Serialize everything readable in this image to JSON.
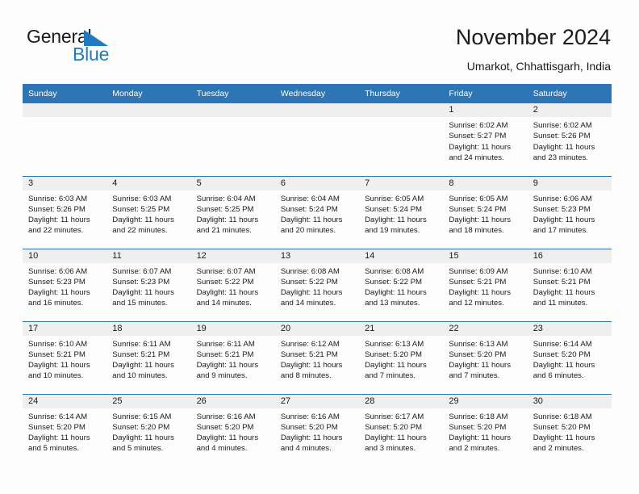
{
  "brand": {
    "name_part1": "General",
    "name_part2": "Blue",
    "triangle_color": "#1f7ac4"
  },
  "header": {
    "title": "November 2024",
    "subtitle": "Umarkot, Chhattisgarh, India"
  },
  "theme": {
    "header_blue": "#2e75b6",
    "daynum_bg": "#efefef",
    "text": "#1b1b1b",
    "page_bg": "#fdfdfd"
  },
  "weekday_headers": [
    "Sunday",
    "Monday",
    "Tuesday",
    "Wednesday",
    "Thursday",
    "Friday",
    "Saturday"
  ],
  "labels": {
    "sunrise_prefix": "Sunrise:",
    "sunset_prefix": "Sunset:",
    "daylight_prefix": "Daylight:"
  },
  "weeks": [
    [
      {
        "day": "",
        "empty": true
      },
      {
        "day": "",
        "empty": true
      },
      {
        "day": "",
        "empty": true
      },
      {
        "day": "",
        "empty": true
      },
      {
        "day": "",
        "empty": true
      },
      {
        "day": "1",
        "sunrise": "Sunrise: 6:02 AM",
        "sunset": "Sunset: 5:27 PM",
        "daylight": "Daylight: 11 hours and 24 minutes."
      },
      {
        "day": "2",
        "sunrise": "Sunrise: 6:02 AM",
        "sunset": "Sunset: 5:26 PM",
        "daylight": "Daylight: 11 hours and 23 minutes."
      }
    ],
    [
      {
        "day": "3",
        "sunrise": "Sunrise: 6:03 AM",
        "sunset": "Sunset: 5:26 PM",
        "daylight": "Daylight: 11 hours and 22 minutes."
      },
      {
        "day": "4",
        "sunrise": "Sunrise: 6:03 AM",
        "sunset": "Sunset: 5:25 PM",
        "daylight": "Daylight: 11 hours and 22 minutes."
      },
      {
        "day": "5",
        "sunrise": "Sunrise: 6:04 AM",
        "sunset": "Sunset: 5:25 PM",
        "daylight": "Daylight: 11 hours and 21 minutes."
      },
      {
        "day": "6",
        "sunrise": "Sunrise: 6:04 AM",
        "sunset": "Sunset: 5:24 PM",
        "daylight": "Daylight: 11 hours and 20 minutes."
      },
      {
        "day": "7",
        "sunrise": "Sunrise: 6:05 AM",
        "sunset": "Sunset: 5:24 PM",
        "daylight": "Daylight: 11 hours and 19 minutes."
      },
      {
        "day": "8",
        "sunrise": "Sunrise: 6:05 AM",
        "sunset": "Sunset: 5:24 PM",
        "daylight": "Daylight: 11 hours and 18 minutes."
      },
      {
        "day": "9",
        "sunrise": "Sunrise: 6:06 AM",
        "sunset": "Sunset: 5:23 PM",
        "daylight": "Daylight: 11 hours and 17 minutes."
      }
    ],
    [
      {
        "day": "10",
        "sunrise": "Sunrise: 6:06 AM",
        "sunset": "Sunset: 5:23 PM",
        "daylight": "Daylight: 11 hours and 16 minutes."
      },
      {
        "day": "11",
        "sunrise": "Sunrise: 6:07 AM",
        "sunset": "Sunset: 5:23 PM",
        "daylight": "Daylight: 11 hours and 15 minutes."
      },
      {
        "day": "12",
        "sunrise": "Sunrise: 6:07 AM",
        "sunset": "Sunset: 5:22 PM",
        "daylight": "Daylight: 11 hours and 14 minutes."
      },
      {
        "day": "13",
        "sunrise": "Sunrise: 6:08 AM",
        "sunset": "Sunset: 5:22 PM",
        "daylight": "Daylight: 11 hours and 14 minutes."
      },
      {
        "day": "14",
        "sunrise": "Sunrise: 6:08 AM",
        "sunset": "Sunset: 5:22 PM",
        "daylight": "Daylight: 11 hours and 13 minutes."
      },
      {
        "day": "15",
        "sunrise": "Sunrise: 6:09 AM",
        "sunset": "Sunset: 5:21 PM",
        "daylight": "Daylight: 11 hours and 12 minutes."
      },
      {
        "day": "16",
        "sunrise": "Sunrise: 6:10 AM",
        "sunset": "Sunset: 5:21 PM",
        "daylight": "Daylight: 11 hours and 11 minutes."
      }
    ],
    [
      {
        "day": "17",
        "sunrise": "Sunrise: 6:10 AM",
        "sunset": "Sunset: 5:21 PM",
        "daylight": "Daylight: 11 hours and 10 minutes."
      },
      {
        "day": "18",
        "sunrise": "Sunrise: 6:11 AM",
        "sunset": "Sunset: 5:21 PM",
        "daylight": "Daylight: 11 hours and 10 minutes."
      },
      {
        "day": "19",
        "sunrise": "Sunrise: 6:11 AM",
        "sunset": "Sunset: 5:21 PM",
        "daylight": "Daylight: 11 hours and 9 minutes."
      },
      {
        "day": "20",
        "sunrise": "Sunrise: 6:12 AM",
        "sunset": "Sunset: 5:21 PM",
        "daylight": "Daylight: 11 hours and 8 minutes."
      },
      {
        "day": "21",
        "sunrise": "Sunrise: 6:13 AM",
        "sunset": "Sunset: 5:20 PM",
        "daylight": "Daylight: 11 hours and 7 minutes."
      },
      {
        "day": "22",
        "sunrise": "Sunrise: 6:13 AM",
        "sunset": "Sunset: 5:20 PM",
        "daylight": "Daylight: 11 hours and 7 minutes."
      },
      {
        "day": "23",
        "sunrise": "Sunrise: 6:14 AM",
        "sunset": "Sunset: 5:20 PM",
        "daylight": "Daylight: 11 hours and 6 minutes."
      }
    ],
    [
      {
        "day": "24",
        "sunrise": "Sunrise: 6:14 AM",
        "sunset": "Sunset: 5:20 PM",
        "daylight": "Daylight: 11 hours and 5 minutes."
      },
      {
        "day": "25",
        "sunrise": "Sunrise: 6:15 AM",
        "sunset": "Sunset: 5:20 PM",
        "daylight": "Daylight: 11 hours and 5 minutes."
      },
      {
        "day": "26",
        "sunrise": "Sunrise: 6:16 AM",
        "sunset": "Sunset: 5:20 PM",
        "daylight": "Daylight: 11 hours and 4 minutes."
      },
      {
        "day": "27",
        "sunrise": "Sunrise: 6:16 AM",
        "sunset": "Sunset: 5:20 PM",
        "daylight": "Daylight: 11 hours and 4 minutes."
      },
      {
        "day": "28",
        "sunrise": "Sunrise: 6:17 AM",
        "sunset": "Sunset: 5:20 PM",
        "daylight": "Daylight: 11 hours and 3 minutes."
      },
      {
        "day": "29",
        "sunrise": "Sunrise: 6:18 AM",
        "sunset": "Sunset: 5:20 PM",
        "daylight": "Daylight: 11 hours and 2 minutes."
      },
      {
        "day": "30",
        "sunrise": "Sunrise: 6:18 AM",
        "sunset": "Sunset: 5:20 PM",
        "daylight": "Daylight: 11 hours and 2 minutes."
      }
    ]
  ]
}
